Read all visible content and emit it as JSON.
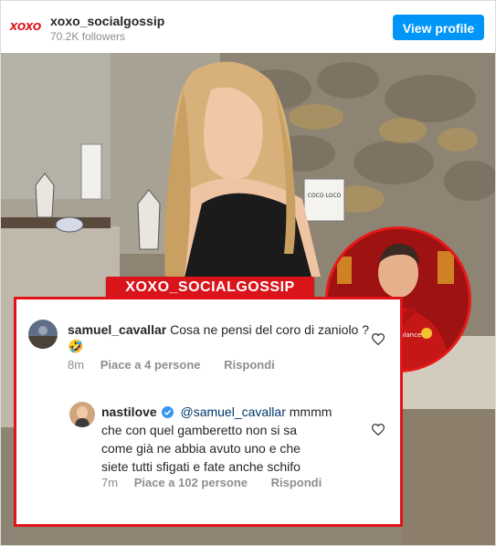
{
  "header": {
    "account_name": "xoxo_socialgossip",
    "followers": "70.2K followers",
    "view_profile_label": "View profile",
    "logo_text": "XOXO"
  },
  "post": {
    "banner_text": "XOXO_SOCIALGOSSIP",
    "shirt_logo": "new balance",
    "sign_text": "COCO LOCO"
  },
  "comments": [
    {
      "username": "samuel_cavallar",
      "text": "Cosa ne pensi del coro di zaniolo ?",
      "emoji": "🤣",
      "time": "8m",
      "likes": "Piace a 4 persone",
      "reply_label": "Rispondi"
    },
    {
      "username": "nastilove",
      "mention": "@samuel_cavallar",
      "text_line1": " mmmm",
      "text_line2": "che con quel gamberetto non si sa",
      "text_line3": "come già ne abbia avuto uno e che",
      "text_line4": "siete tutti sfigati e fate anche schifo",
      "time": "7m",
      "likes": "Piace a 102 persone",
      "reply_label": "Rispondi"
    }
  ],
  "colors": {
    "accent_blue": "#0095f6",
    "brand_red": "#d9141b",
    "text_dark": "#262626",
    "text_muted": "#8e8e8e"
  },
  "icons": [
    "heart-icon",
    "verified-badge-icon",
    "laughing-emoji-icon"
  ]
}
